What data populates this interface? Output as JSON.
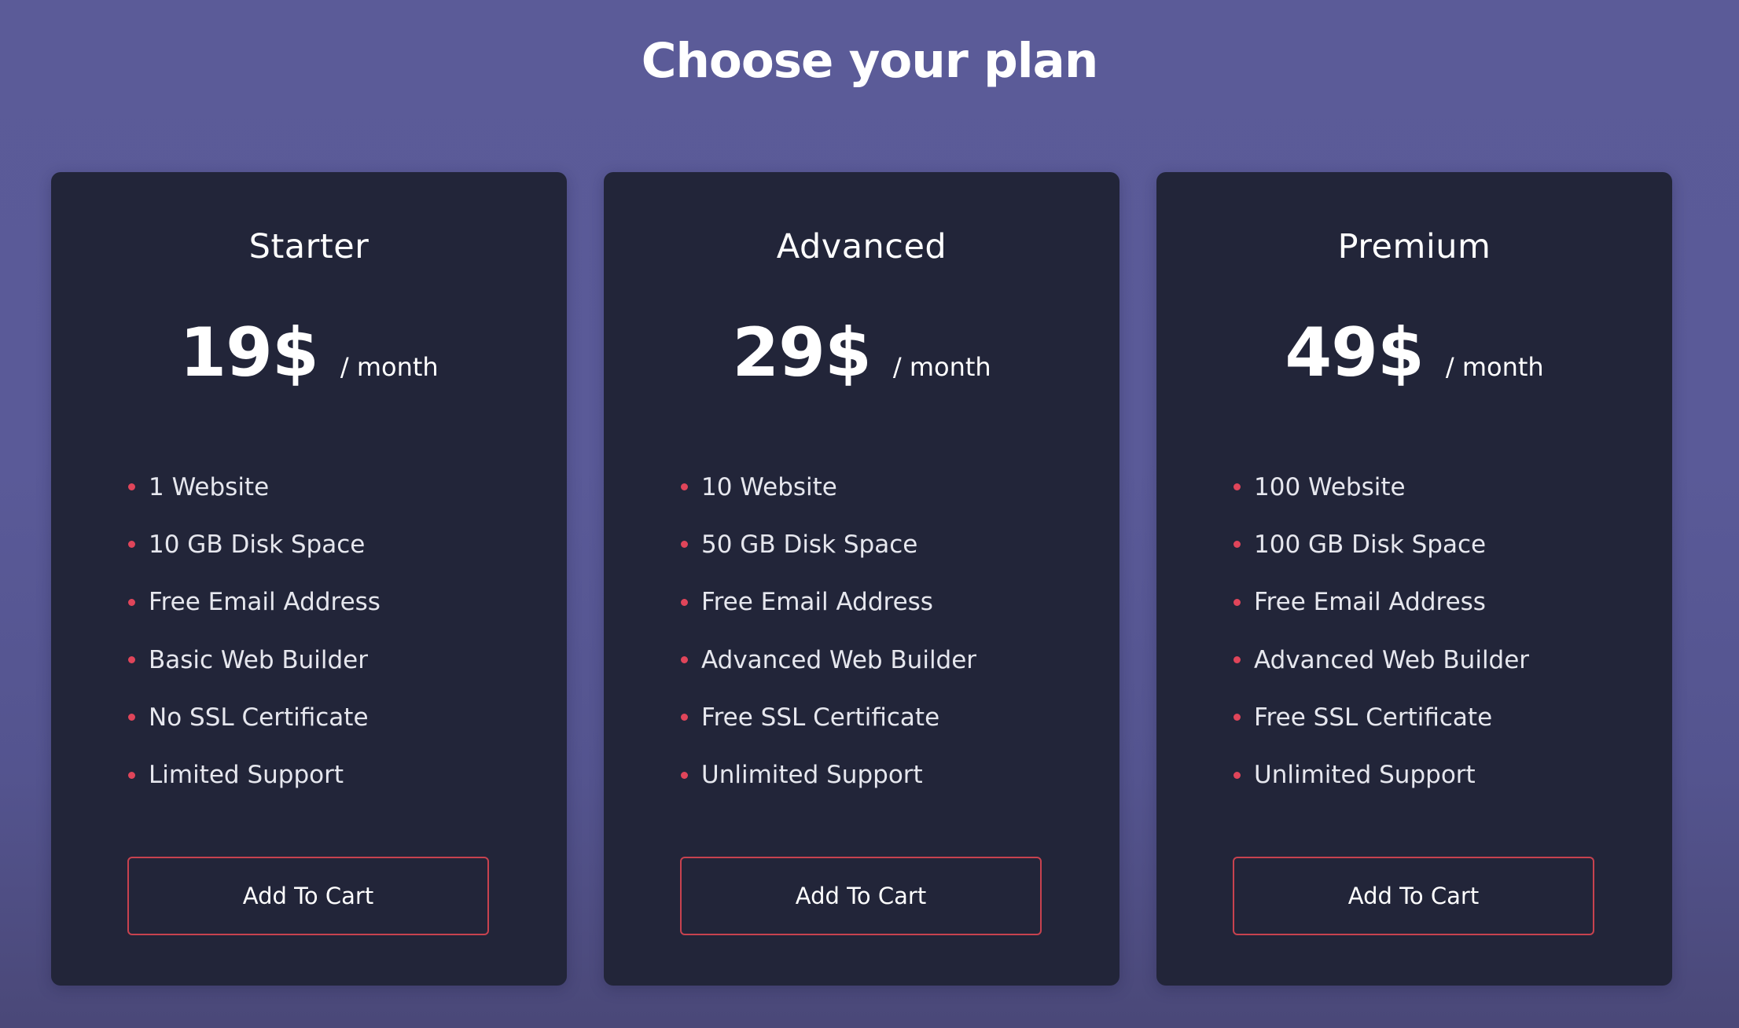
{
  "header": {
    "title": "Choose your plan"
  },
  "colors": {
    "background": "#5b5b98",
    "card": "#222539",
    "accent": "#e0455a",
    "button_border": "#c7424f",
    "text": "#ffffff"
  },
  "plans": [
    {
      "name": "Starter",
      "price": "19$",
      "period": "/ month",
      "features": [
        "1 Website",
        "10 GB Disk Space",
        "Free Email Address",
        "Basic Web Builder",
        "No SSL Certificate",
        "Limited Support"
      ],
      "button_label": "Add To Cart"
    },
    {
      "name": "Advanced",
      "price": "29$",
      "period": "/ month",
      "features": [
        "10 Website",
        "50 GB Disk Space",
        "Free Email Address",
        "Advanced Web Builder",
        "Free SSL Certificate",
        "Unlimited Support"
      ],
      "button_label": "Add To Cart"
    },
    {
      "name": "Premium",
      "price": "49$",
      "period": "/ month",
      "features": [
        "100 Website",
        "100 GB Disk Space",
        "Free Email Address",
        "Advanced Web Builder",
        "Free SSL Certificate",
        "Unlimited Support"
      ],
      "button_label": "Add To Cart"
    }
  ]
}
